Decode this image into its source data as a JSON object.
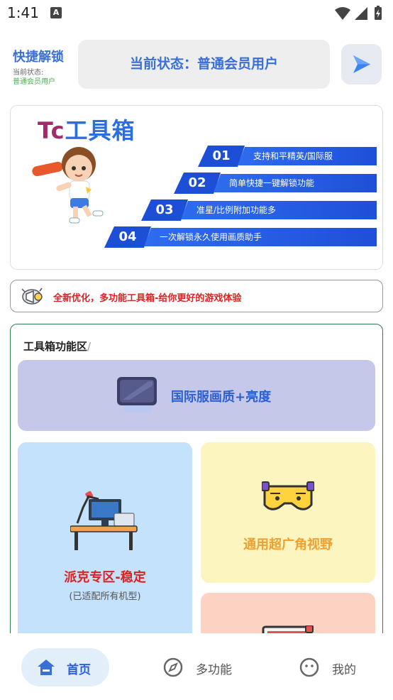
{
  "status_bar": {
    "time": "1:41",
    "notification_icon": "A"
  },
  "header": {
    "title": "快捷解锁",
    "status_label": "当前状态:",
    "status_value": "普通会员用户",
    "status_box_text": "当前状态：普通会员用户",
    "play_icon": "play-icon"
  },
  "banner": {
    "title_prefix": "Tc",
    "title_main": "工具箱",
    "features": [
      {
        "num": "01",
        "text": "支持和平精英/国际服"
      },
      {
        "num": "02",
        "text": "简单快捷一键解锁功能"
      },
      {
        "num": "03",
        "text": "准星/比例附加功能多"
      },
      {
        "num": "04",
        "text": "一次解锁永久使用画质助手"
      }
    ]
  },
  "notice": {
    "text": "全新优化，多功能工具箱-给你更好的游戏体验",
    "icon": "megaphone-icon"
  },
  "tools": {
    "title": "工具箱功能区",
    "title_suffix": "/",
    "cards": {
      "intl": {
        "label": "国际服画质+亮度",
        "icon": "monitor-icon"
      },
      "pake": {
        "label": "派克专区-稳定",
        "sub": "(已适配所有机型)",
        "icon": "desk-icon"
      },
      "wide": {
        "label": "通用超广角视野",
        "icon": "vr-glasses-icon"
      },
      "extra": {
        "icon": "keyboard-icon"
      }
    }
  },
  "nav": {
    "items": [
      {
        "label": "首页",
        "icon": "home-icon"
      },
      {
        "label": "多功能",
        "icon": "compass-icon"
      },
      {
        "label": "我的",
        "icon": "face-icon"
      }
    ]
  },
  "colors": {
    "accent": "#3b6fd8",
    "red": "#e02020",
    "green": "#4caf50"
  }
}
